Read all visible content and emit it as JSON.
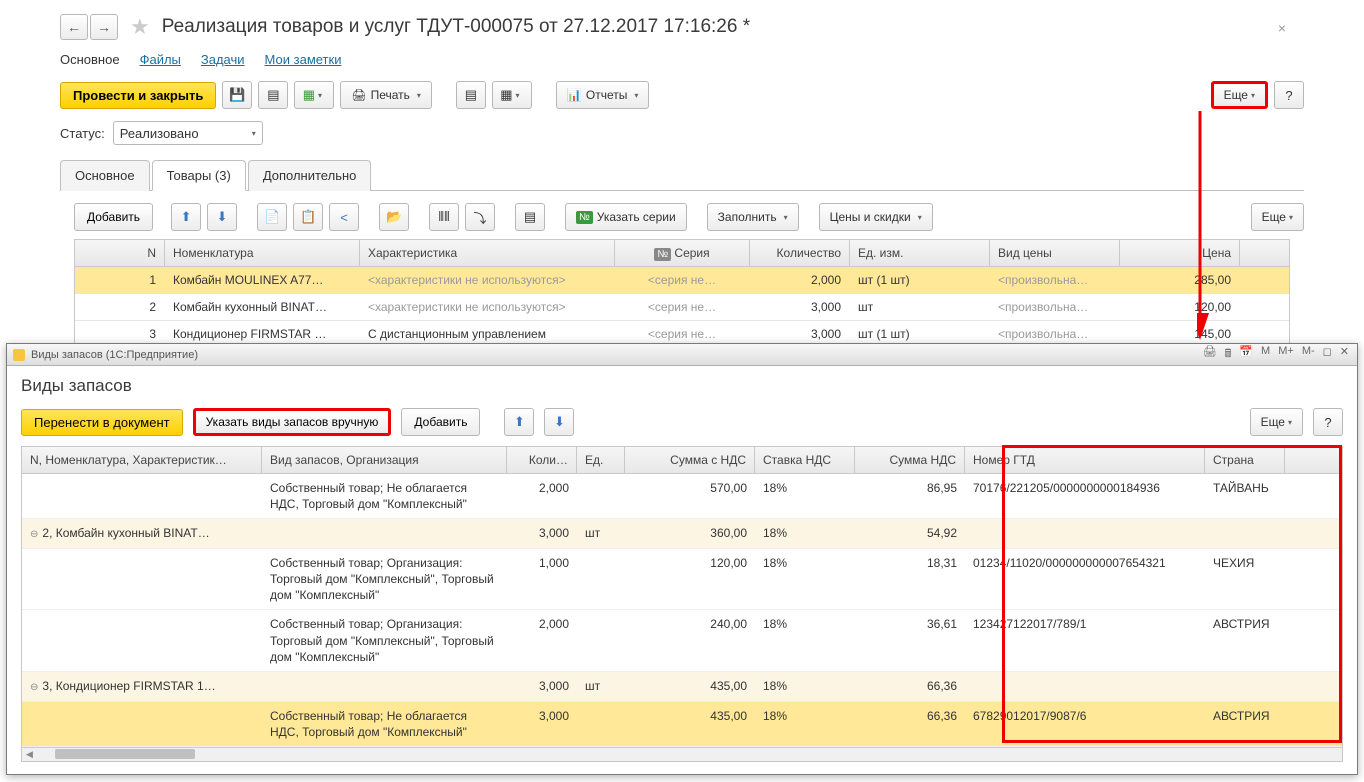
{
  "title": "Реализация товаров и услуг ТДУТ-000075 от 27.12.2017 17:16:26 *",
  "nav_links": {
    "main": "Основное",
    "files": "Файлы",
    "tasks": "Задачи",
    "notes": "Мои заметки"
  },
  "toolbar": {
    "post_close": "Провести и закрыть",
    "print": "Печать",
    "reports": "Отчеты",
    "more": "Еще",
    "help": "?"
  },
  "status": {
    "label": "Статус:",
    "value": "Реализовано"
  },
  "tabs": {
    "main": "Основное",
    "goods": "Товары (3)",
    "extra": "Дополнительно"
  },
  "inner_toolbar": {
    "add": "Добавить",
    "series": "Указать серии",
    "fill": "Заполнить",
    "prices": "Цены и скидки",
    "more": "Еще"
  },
  "grid_headers": {
    "n": "N",
    "nom": "Номенклатура",
    "char": "Характеристика",
    "ser": "Серия",
    "qty": "Количество",
    "um": "Ед. изм.",
    "ptype": "Вид цены",
    "price": "Цена"
  },
  "grid_rows": [
    {
      "n": "1",
      "nom": "Комбайн MOULINEX  A77…",
      "char": "<характеристики не используются>",
      "ser": "<серия не…",
      "qty": "2,000",
      "um": "шт (1 шт)",
      "ptype": "<произвольна…",
      "price": "285,00"
    },
    {
      "n": "2",
      "nom": "Комбайн кухонный BINAT…",
      "char": "<характеристики не используются>",
      "ser": "<серия не…",
      "qty": "3,000",
      "um": "шт",
      "ptype": "<произвольна…",
      "price": "120,00"
    },
    {
      "n": "3",
      "nom": "Кондиционер FIRMSTAR …",
      "char": "С дистанционным управлением",
      "ser": "<серия не…",
      "qty": "3,000",
      "um": "шт (1 шт)",
      "ptype": "<произвольна…",
      "price": "145,00"
    }
  ],
  "popup": {
    "window_title": "Виды запасов  (1С:Предприятие)",
    "heading": "Виды запасов",
    "toolbar": {
      "transfer": "Перенести в документ",
      "manual": "Указать виды запасов вручную",
      "add": "Добавить",
      "more": "Еще",
      "help": "?"
    },
    "headers": {
      "n": "N, Номенклатура, Характеристик…",
      "vid": "Вид запасов, Организация",
      "qty": "Коли…",
      "ed": "Ед.",
      "sum": "Сумма с НДС",
      "vat": "Ставка НДС",
      "vatsum": "Сумма НДС",
      "gtd": "Номер ГТД",
      "country": "Страна"
    },
    "rows": [
      {
        "kind": "leaf",
        "n": "",
        "vid": "Собственный товар; Не облагается НДС, Торговый дом \"Комплексный\"",
        "qty": "2,000",
        "ed": "",
        "sum": "570,00",
        "vat": "18%",
        "vatsum": "86,95",
        "gtd": "70176/221205/0000000000184936",
        "country": "ТАЙВАНЬ"
      },
      {
        "kind": "group",
        "n": "2, Комбайн кухонный BINAT…",
        "vid": "",
        "qty": "3,000",
        "ed": "шт",
        "sum": "360,00",
        "vat": "18%",
        "vatsum": "54,92",
        "gtd": "",
        "country": ""
      },
      {
        "kind": "leaf",
        "n": "",
        "vid": "Собственный товар; Организация: Торговый дом \"Комплексный\", Торговый дом \"Комплексный\"",
        "qty": "1,000",
        "ed": "",
        "sum": "120,00",
        "vat": "18%",
        "vatsum": "18,31",
        "gtd": "01234/11020/000000000007654321",
        "country": "ЧЕХИЯ"
      },
      {
        "kind": "leaf",
        "n": "",
        "vid": "Собственный товар; Организация: Торговый дом \"Комплексный\", Торговый дом \"Комплексный\"",
        "qty": "2,000",
        "ed": "",
        "sum": "240,00",
        "vat": "18%",
        "vatsum": "36,61",
        "gtd": "123427122017/789/1",
        "country": "АВСТРИЯ"
      },
      {
        "kind": "group",
        "n": "3, Кондиционер FIRMSTAR 1…",
        "vid": "",
        "qty": "3,000",
        "ed": "шт",
        "sum": "435,00",
        "vat": "18%",
        "vatsum": "66,36",
        "gtd": "",
        "country": ""
      },
      {
        "kind": "leaf-sel",
        "n": "",
        "vid": "Собственный товар; Не облагается НДС, Торговый дом \"Комплексный\"",
        "qty": "3,000",
        "ed": "",
        "sum": "435,00",
        "vat": "18%",
        "vatsum": "66,36",
        "gtd": "67829012017/9087/6",
        "country": "АВСТРИЯ"
      }
    ],
    "titlebar_icons": {
      "m": "M",
      "mp": "M+",
      "mm": "M-"
    }
  }
}
